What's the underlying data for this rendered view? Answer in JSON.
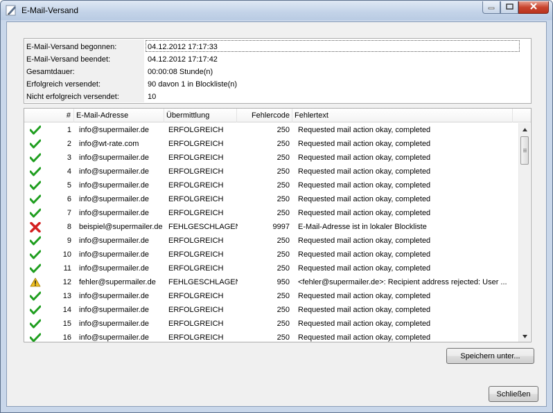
{
  "window": {
    "title": "E-Mail-Versand",
    "minimize_icon": "minimize-icon",
    "maximize_icon": "maximize-icon",
    "close_icon": "close-icon"
  },
  "summary": [
    {
      "label": "E-Mail-Versand begonnen:",
      "value": "04.12.2012 17:17:33"
    },
    {
      "label": "E-Mail-Versand beendet:",
      "value": "04.12.2012 17:17:42"
    },
    {
      "label": "Gesamtdauer:",
      "value": "00:00:08 Stunde(n)"
    },
    {
      "label": "Erfolgreich versendet:",
      "value": "90 davon 1 in Blockliste(n)"
    },
    {
      "label": "Nicht erfolgreich versendet:",
      "value": "10"
    }
  ],
  "table": {
    "columns": [
      "#",
      "E-Mail-Adresse",
      "Übermittlung",
      "Fehlercode",
      "Fehlertext"
    ],
    "rows": [
      {
        "status": "success",
        "num": "1",
        "email": "info@supermailer.de",
        "transfer": "ERFOLGREICH",
        "code": "250",
        "text": "Requested mail action okay, completed"
      },
      {
        "status": "success",
        "num": "2",
        "email": "info@wt-rate.com",
        "transfer": "ERFOLGREICH",
        "code": "250",
        "text": "Requested mail action okay, completed"
      },
      {
        "status": "success",
        "num": "3",
        "email": "info@supermailer.de",
        "transfer": "ERFOLGREICH",
        "code": "250",
        "text": "Requested mail action okay, completed"
      },
      {
        "status": "success",
        "num": "4",
        "email": "info@supermailer.de",
        "transfer": "ERFOLGREICH",
        "code": "250",
        "text": "Requested mail action okay, completed"
      },
      {
        "status": "success",
        "num": "5",
        "email": "info@supermailer.de",
        "transfer": "ERFOLGREICH",
        "code": "250",
        "text": "Requested mail action okay, completed"
      },
      {
        "status": "success",
        "num": "6",
        "email": "info@supermailer.de",
        "transfer": "ERFOLGREICH",
        "code": "250",
        "text": "Requested mail action okay, completed"
      },
      {
        "status": "success",
        "num": "7",
        "email": "info@supermailer.de",
        "transfer": "ERFOLGREICH",
        "code": "250",
        "text": "Requested mail action okay, completed"
      },
      {
        "status": "error",
        "num": "8",
        "email": "beispiel@supermailer.de",
        "transfer": "FEHLGESCHLAGEN",
        "code": "9997",
        "text": "E-Mail-Adresse ist in lokaler Blockliste"
      },
      {
        "status": "success",
        "num": "9",
        "email": "info@supermailer.de",
        "transfer": "ERFOLGREICH",
        "code": "250",
        "text": "Requested mail action okay, completed"
      },
      {
        "status": "success",
        "num": "10",
        "email": "info@supermailer.de",
        "transfer": "ERFOLGREICH",
        "code": "250",
        "text": "Requested mail action okay, completed"
      },
      {
        "status": "success",
        "num": "11",
        "email": "info@supermailer.de",
        "transfer": "ERFOLGREICH",
        "code": "250",
        "text": "Requested mail action okay, completed"
      },
      {
        "status": "warning",
        "num": "12",
        "email": "fehler@supermailer.de",
        "transfer": "FEHLGESCHLAGEN",
        "code": "950",
        "text": "<fehler@supermailer.de>: Recipient address rejected: User ..."
      },
      {
        "status": "success",
        "num": "13",
        "email": "info@supermailer.de",
        "transfer": "ERFOLGREICH",
        "code": "250",
        "text": "Requested mail action okay, completed"
      },
      {
        "status": "success",
        "num": "14",
        "email": "info@supermailer.de",
        "transfer": "ERFOLGREICH",
        "code": "250",
        "text": "Requested mail action okay, completed"
      },
      {
        "status": "success",
        "num": "15",
        "email": "info@supermailer.de",
        "transfer": "ERFOLGREICH",
        "code": "250",
        "text": "Requested mail action okay, completed"
      },
      {
        "status": "success",
        "num": "16",
        "email": "info@supermailer.de",
        "transfer": "ERFOLGREICH",
        "code": "250",
        "text": "Requested mail action okay, completed"
      }
    ]
  },
  "buttons": {
    "save_as": "Speichern unter...",
    "close": "Schließen"
  },
  "colors": {
    "success": "#1f9e1f",
    "error": "#d42020",
    "warning": "#f0c020"
  }
}
